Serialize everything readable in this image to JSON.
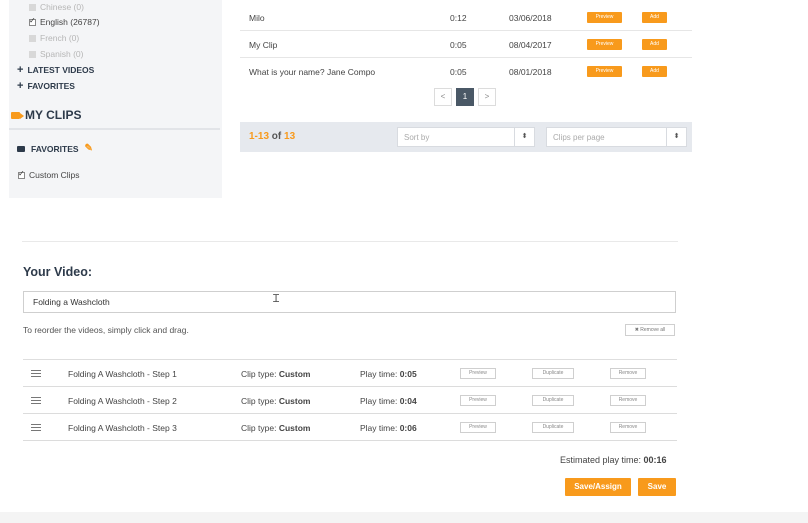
{
  "sidebar": {
    "languages": [
      {
        "label": "Chinese (0)",
        "checked": false
      },
      {
        "label": "English (26787)",
        "checked": true
      },
      {
        "label": "French (0)",
        "checked": false
      },
      {
        "label": "Spanish (0)",
        "checked": false
      }
    ],
    "latest_videos": "LATEST VIDEOS",
    "favorites": "FAVORITES",
    "my_clips": "MY CLIPS",
    "favorites_folder": "FAVORITES",
    "custom_clips": "Custom Clips"
  },
  "results": {
    "rows": [
      {
        "title": "Milo",
        "duration": "0:12",
        "date": "03/06/2018",
        "preview": "Preview",
        "add": "Add"
      },
      {
        "title": "My Clip",
        "duration": "0:05",
        "date": "08/04/2017",
        "preview": "Preview",
        "add": "Add"
      },
      {
        "title": "What is your name? Jane Compo",
        "duration": "0:05",
        "date": "08/01/2018",
        "preview": "Preview",
        "add": "Add"
      }
    ],
    "pagination": {
      "prev": "<",
      "current": "1",
      "next": ">"
    },
    "count_range": "1-13",
    "count_of": "of",
    "count_total": "13",
    "sort_by": "Sort by",
    "clips_per_page": "Clips per page"
  },
  "your_video": {
    "title": "Your Video:",
    "name_value": "Folding a Washcloth",
    "reorder_hint": "To reorder the videos, simply click and drag.",
    "remove_all": "✖ Remove all",
    "clip_type_label": "Clip type:",
    "play_time_label": "Play time:",
    "clips": [
      {
        "name": "Folding A Washcloth - Step 1",
        "clip_type": "Custom",
        "play_time": "0:05"
      },
      {
        "name": "Folding A Washcloth - Step 2",
        "clip_type": "Custom",
        "play_time": "0:04"
      },
      {
        "name": "Folding A Washcloth - Step 3",
        "clip_type": "Custom",
        "play_time": "0:06"
      }
    ],
    "btn_preview": "Preview",
    "btn_duplicate": "Duplicate",
    "btn_remove": "Remove",
    "estimated_label": "Estimated play time:",
    "estimated_value": "00:16",
    "save_assign": "Save/Assign",
    "save": "Save"
  },
  "colors": {
    "accent": "#f89a1c",
    "heading": "#2d3a4a",
    "panel": "#f4f5f7",
    "results_bar": "#e6e9ee"
  }
}
